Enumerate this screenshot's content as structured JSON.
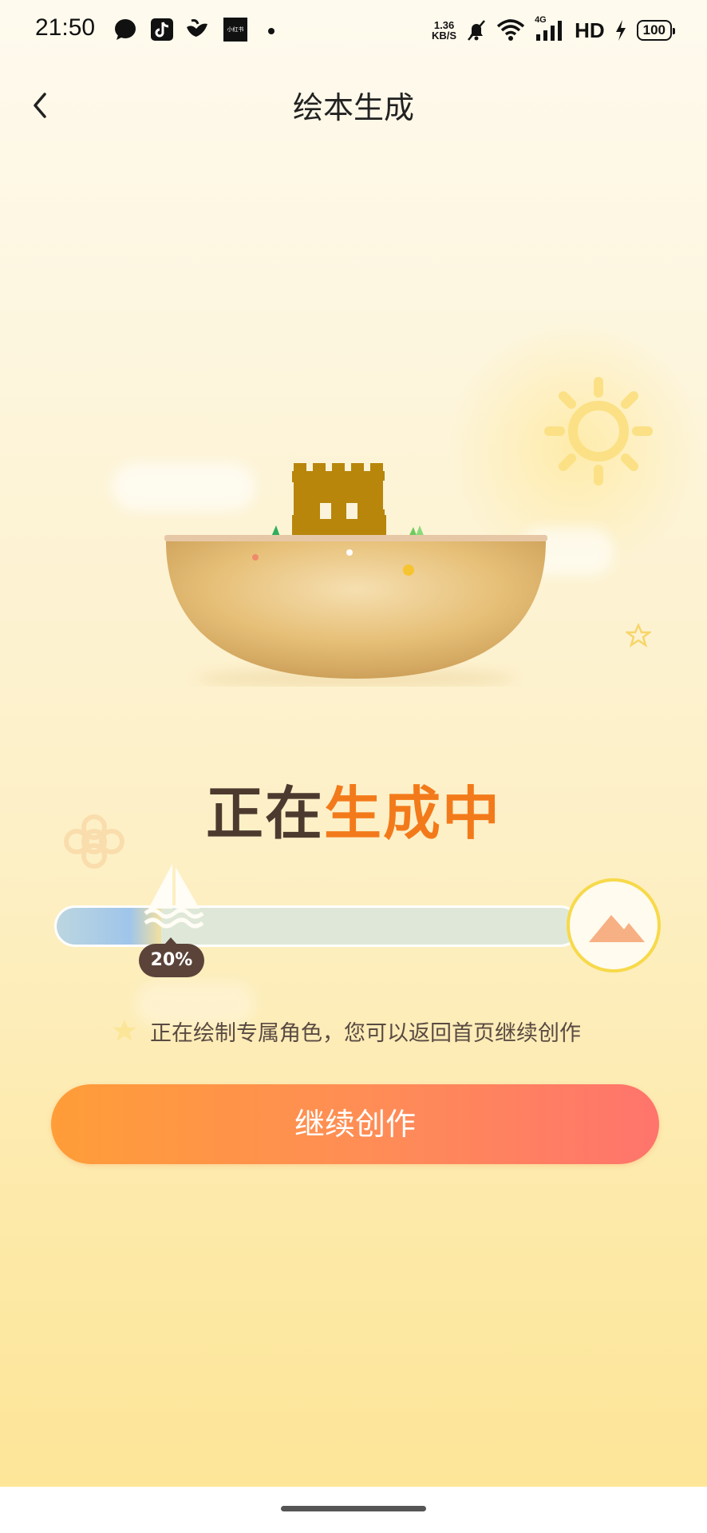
{
  "status_bar": {
    "time": "21:50",
    "notification_icons": [
      "chat-bubble-icon",
      "tiktok-icon",
      "bird-app-icon",
      "xiaohongshu-icon"
    ],
    "xiaohongshu_label": "小红书",
    "net_speed_value": "1.36",
    "net_speed_unit": "KB/S",
    "network_label": "4G",
    "hd_label": "HD",
    "battery": "100"
  },
  "header": {
    "title": "绘本生成",
    "back_icon": "chevron-left-icon"
  },
  "main": {
    "heading_part1": "正在",
    "heading_part2": "生成中",
    "progress": {
      "value": 0.2,
      "label": "20%"
    },
    "hint": "正在绘制专属角色，您可以返回首页继续创作",
    "continue_button": "继续创作"
  },
  "colors": {
    "accent_orange": "#f37a1a",
    "heading_dark": "#4d3a2f",
    "button_start": "#ff9d38",
    "button_end": "#ff746c",
    "progress_badge": "#5b433a",
    "goal_ring": "#f7d94a"
  }
}
